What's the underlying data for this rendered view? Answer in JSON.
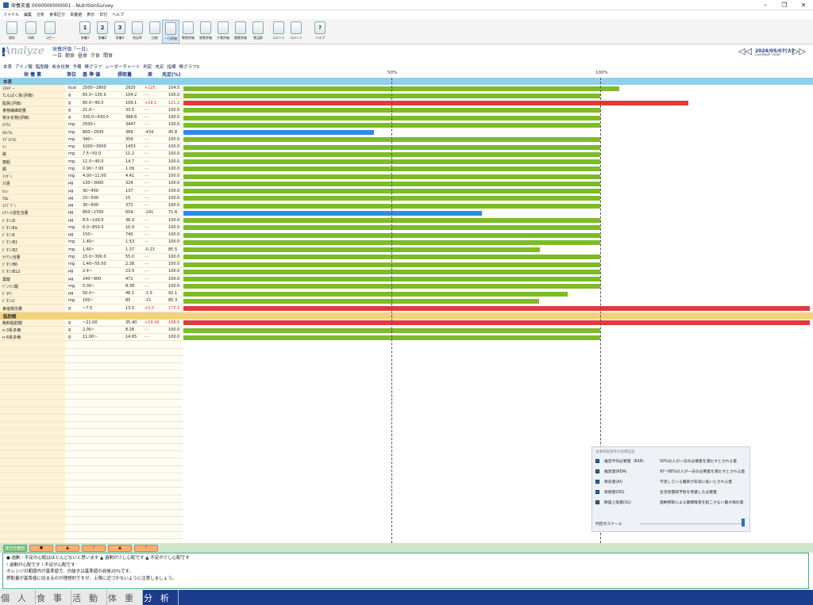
{
  "window": {
    "title": "栄養支援 0000000000001 - NutritionSurvey"
  },
  "menu": [
    "ファイル",
    "編集",
    "分析",
    "食事区分",
    "栄養値",
    "表示",
    "日付",
    "ヘルプ"
  ],
  "toolbar": [
    {
      "label": "保存",
      "icon": "save-icon"
    },
    {
      "label": "印刷",
      "icon": "print-icon"
    },
    {
      "label": "コピー",
      "icon": "copy-icon"
    },
    {
      "label": "栄養1",
      "icon": "page-1-icon"
    },
    {
      "label": "栄養2",
      "icon": "page-2-icon"
    },
    {
      "label": "栄養3",
      "icon": "page-3-icon"
    },
    {
      "label": "充足率",
      "icon": "chart-icon"
    },
    {
      "label": "比較",
      "icon": "compare-icon"
    },
    {
      "label": "一日評価",
      "icon": "day-icon"
    },
    {
      "label": "朝食評価",
      "icon": "breakfast-icon"
    },
    {
      "label": "昼食評価",
      "icon": "lunch-icon"
    },
    {
      "label": "夕食評価",
      "icon": "dinner-icon"
    },
    {
      "label": "間食評価",
      "icon": "snack-icon"
    },
    {
      "label": "食品群",
      "icon": "group-icon"
    },
    {
      "label": "コメント",
      "icon": "comment-icon"
    },
    {
      "label": "コメント",
      "icon": "comment2-icon"
    },
    {
      "label": "ヘルプ",
      "icon": "help-icon"
    }
  ],
  "header": {
    "app": "Analyze",
    "eval_title": "栄養評価「一日」",
    "meals": [
      "一日",
      "朝食",
      "昼食",
      "夕食",
      "間食"
    ],
    "date": "2024/05/07(火)",
    "date_sub": "CALENDAR  TODAY"
  },
  "options": [
    "本表",
    "アミノ酸",
    "脂肪酸",
    "炭水化物",
    "予備",
    "棒グラフ",
    "レーダーチャート",
    "判定",
    "充足",
    "指標",
    "棒グラフ0"
  ],
  "columns": {
    "name": "栄 養 素",
    "unit": "単位",
    "std": "基 準 値",
    "intake": "摂取量",
    "diff": "差",
    "rate": "充足(%)"
  },
  "scale": {
    "p50": "50%",
    "p100": "100%"
  },
  "colors": {
    "green": "#7cbc28",
    "red": "#e23a3a",
    "blue": "#2d8be6"
  },
  "sections": {
    "main": "本表",
    "fat": "脂肪酸"
  },
  "rows": [
    {
      "n": "ｴﾈﾙｷﾞｰ",
      "u": "kcal",
      "s": "2500~2800",
      "i": "2925",
      "d": "+125",
      "r": "104.5",
      "c": "green",
      "v": 104.5
    },
    {
      "n": "たんぱく質(評価)",
      "u": "g",
      "s": "65.0~135.0",
      "i": "104.2",
      "d": "---",
      "r": "100.0",
      "c": "green",
      "v": 100
    },
    {
      "n": "脂質(評価)",
      "u": "g",
      "s": "60.0~90.0",
      "i": "109.1",
      "d": "+19.1",
      "r": "121.2",
      "c": "red",
      "v": 121.2
    },
    {
      "n": "食物繊維総量",
      "u": "g",
      "s": "21.0~",
      "i": "33.5",
      "d": "---",
      "r": "100.0",
      "c": "green",
      "v": 100
    },
    {
      "n": "炭水化物(評価)",
      "u": "g",
      "s": "330.0~430.0",
      "i": "388.8",
      "d": "---",
      "r": "100.0",
      "c": "green",
      "v": 100
    },
    {
      "n": "ｶﾘｳﾑ",
      "u": "mg",
      "s": "2500~",
      "i": "3447",
      "d": "---",
      "r": "100.0",
      "c": "green",
      "v": 100
    },
    {
      "n": "ｶﾙｼｳﾑ",
      "u": "mg",
      "s": "800~2500",
      "i": "366",
      "d": "-434",
      "r": "45.8",
      "c": "blue",
      "v": 45.8
    },
    {
      "n": "ﾏｸﾞﾈｼｳﾑ",
      "u": "mg",
      "s": "340~",
      "i": "359",
      "d": "---",
      "r": "100.0",
      "c": "green",
      "v": 100
    },
    {
      "n": "ﾘﾝ",
      "u": "mg",
      "s": "1000~3000",
      "i": "1453",
      "d": "---",
      "r": "100.0",
      "c": "green",
      "v": 100
    },
    {
      "n": "鉄",
      "u": "mg",
      "s": "7.5~50.0",
      "i": "11.2",
      "d": "---",
      "r": "100.0",
      "c": "green",
      "v": 100
    },
    {
      "n": "亜鉛",
      "u": "mg",
      "s": "11.0~40.0",
      "i": "14.7",
      "d": "---",
      "r": "100.0",
      "c": "green",
      "v": 100
    },
    {
      "n": "銅",
      "u": "mg",
      "s": "0.90~7.00",
      "i": "1.09",
      "d": "---",
      "r": "100.0",
      "c": "green",
      "v": 100
    },
    {
      "n": "ﾏﾝｶﾞﾝ",
      "u": "mg",
      "s": "4.00~11.00",
      "i": "4.41",
      "d": "---",
      "r": "100.0",
      "c": "green",
      "v": 100
    },
    {
      "n": "ﾖｳ素",
      "u": "µg",
      "s": "130~3000",
      "i": "329",
      "d": "---",
      "r": "100.0",
      "c": "green",
      "v": 100
    },
    {
      "n": "ｾﾚﾝ",
      "u": "µg",
      "s": "30~450",
      "i": "137",
      "d": "---",
      "r": "100.0",
      "c": "green",
      "v": 100
    },
    {
      "n": "ｸﾛﾑ",
      "u": "µg",
      "s": "10~500",
      "i": "15",
      "d": "---",
      "r": "100.0",
      "c": "green",
      "v": 100
    },
    {
      "n": "ﾓﾘﾌﾞﾃﾞﾝ",
      "u": "µg",
      "s": "30~600",
      "i": "372",
      "d": "---",
      "r": "100.0",
      "c": "green",
      "v": 100
    },
    {
      "n": "ﾚﾁﾉｰﾙ活性当量",
      "u": "µg",
      "s": "850~2700",
      "i": "609",
      "d": "-241",
      "r": "71.6",
      "c": "blue",
      "v": 71.6
    },
    {
      "n": "ﾋﾞﾀﾐﾝD",
      "u": "µg",
      "s": "8.5~100.0",
      "i": "36.0",
      "d": "---",
      "r": "100.0",
      "c": "green",
      "v": 100
    },
    {
      "n": "ﾋﾞﾀﾐﾝEα",
      "u": "mg",
      "s": "6.0~850.0",
      "i": "10.9",
      "d": "---",
      "r": "100.0",
      "c": "green",
      "v": 100
    },
    {
      "n": "ﾋﾞﾀﾐﾝK",
      "u": "µg",
      "s": "150~",
      "i": "740",
      "d": "---",
      "r": "100.0",
      "c": "green",
      "v": 100
    },
    {
      "n": "ﾋﾞﾀﾐﾝB1",
      "u": "mg",
      "s": "1.40~",
      "i": "1.53",
      "d": "---",
      "r": "100.0",
      "c": "green",
      "v": 100
    },
    {
      "n": "ﾋﾞﾀﾐﾝB2",
      "u": "mg",
      "s": "1.60~",
      "i": "1.37",
      "d": "-0.23",
      "r": "85.5",
      "c": "green",
      "v": 85.5
    },
    {
      "n": "ﾅｲｱｼﾝ当量",
      "u": "mg",
      "s": "15.0~300.0",
      "i": "55.0",
      "d": "---",
      "r": "100.0",
      "c": "green",
      "v": 100
    },
    {
      "n": "ﾋﾞﾀﾐﾝB6",
      "u": "mg",
      "s": "1.40~55.00",
      "i": "2.38",
      "d": "---",
      "r": "100.0",
      "c": "green",
      "v": 100
    },
    {
      "n": "ﾋﾞﾀﾐﾝB12",
      "u": "µg",
      "s": "2.4~",
      "i": "23.5",
      "d": "---",
      "r": "100.0",
      "c": "green",
      "v": 100
    },
    {
      "n": "葉酸",
      "u": "µg",
      "s": "240~900",
      "i": "471",
      "d": "---",
      "r": "100.0",
      "c": "green",
      "v": 100
    },
    {
      "n": "ﾊﾟﾝﾄﾃﾝ酸",
      "u": "mg",
      "s": "5.00~",
      "i": "8.38",
      "d": "---",
      "r": "100.0",
      "c": "green",
      "v": 100
    },
    {
      "n": "ﾋﾞｵﾁﾝ",
      "u": "µg",
      "s": "50.0~",
      "i": "46.1",
      "d": "-3.9",
      "r": "92.1",
      "c": "green",
      "v": 92.1
    },
    {
      "n": "ﾋﾞﾀﾐﾝC",
      "u": "mg",
      "s": "100~",
      "i": "85",
      "d": "-15",
      "r": "85.3",
      "c": "green",
      "v": 85.3
    },
    {
      "n": "食塩相当量",
      "u": "g",
      "s": "~7.5",
      "i": "13.0",
      "d": "+5.5",
      "r": "173.3",
      "c": "red",
      "v": 173.3
    }
  ],
  "fat_rows": [
    {
      "n": "飽和脂肪酸",
      "u": "g",
      "s": "~21.00",
      "i": "35.40",
      "d": "+14.40",
      "r": "168.6",
      "c": "red",
      "v": 168.6
    },
    {
      "n": "n-3系多価",
      "u": "g",
      "s": "2.00~",
      "i": "8.26",
      "d": "---",
      "r": "100.0",
      "c": "green",
      "v": 100
    },
    {
      "n": "n-6系多価",
      "u": "g",
      "s": "11.00~",
      "i": "14.65",
      "d": "---",
      "r": "100.0",
      "c": "green",
      "v": 100
    }
  ],
  "legend": {
    "title": "食事摂取基準の指標設定",
    "items": [
      {
        "n": "推定平均必要量（EAR）",
        "d": "50%の人が一日の必要量を満たすとされる量"
      },
      {
        "n": "推奨量(RDA)",
        "d": "97~98%の人が一日の必要量を満たすとされる量"
      },
      {
        "n": "目安量(AI)",
        "d": "不足している確率が非常に低いとされる量"
      },
      {
        "n": "目標量(DG)",
        "d": "生活習慣病予防を考慮した必要量"
      },
      {
        "n": "耐容上限量(UL)",
        "d": "過剰摂取による健康障害を起こさない最大限の量"
      }
    ],
    "scale_label": "判定のスケール"
  },
  "filters": [
    "すべて表示",
    "●",
    "▲",
    "!",
    "▲",
    "!"
  ],
  "notice": [
    "● 過剰・不足の心配はほとんどないと思います  ▲ 過剰が少し心配です  ▲ 不足が少し心配です",
    "! 過剰が心配です  ! 不足が心配です",
    "オレンジの範囲内が基準値で、白抜きは基準値の前後20%です。",
    "摂取量が基準値に収まるのが理想的ですが、上限に近づかないように注意しましょう。"
  ],
  "nav": [
    "個人",
    "食事",
    "活動",
    "体重",
    "分析"
  ]
}
